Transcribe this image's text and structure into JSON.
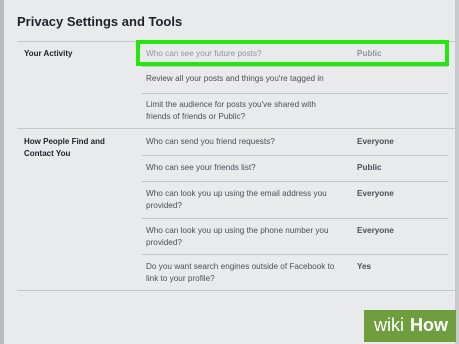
{
  "page": {
    "title": "Privacy Settings and Tools"
  },
  "sections": [
    {
      "label": "Your Activity",
      "rows": [
        {
          "question": "Who can see your future posts?",
          "value": "Public"
        },
        {
          "question": "Review all your posts and things you're tagged in",
          "value": ""
        },
        {
          "question": "Limit the audience for posts you've shared with friends of friends or Public?",
          "value": ""
        }
      ]
    },
    {
      "label": "How People Find and Contact You",
      "rows": [
        {
          "question": "Who can send you friend requests?",
          "value": "Everyone"
        },
        {
          "question": "Who can see your friends list?",
          "value": "Public"
        },
        {
          "question": "Who can look you up using the email address you provided?",
          "value": "Everyone"
        },
        {
          "question": "Who can look you up using the phone number you provided?",
          "value": "Everyone"
        },
        {
          "question": "Do you want search engines outside of Facebook to link to your profile?",
          "value": "Yes"
        }
      ]
    }
  ],
  "watermark": {
    "wiki": "wiki",
    "how": "How"
  },
  "colors": {
    "highlight": "#25e60f",
    "watermark_bg": "#6e9e3e"
  }
}
